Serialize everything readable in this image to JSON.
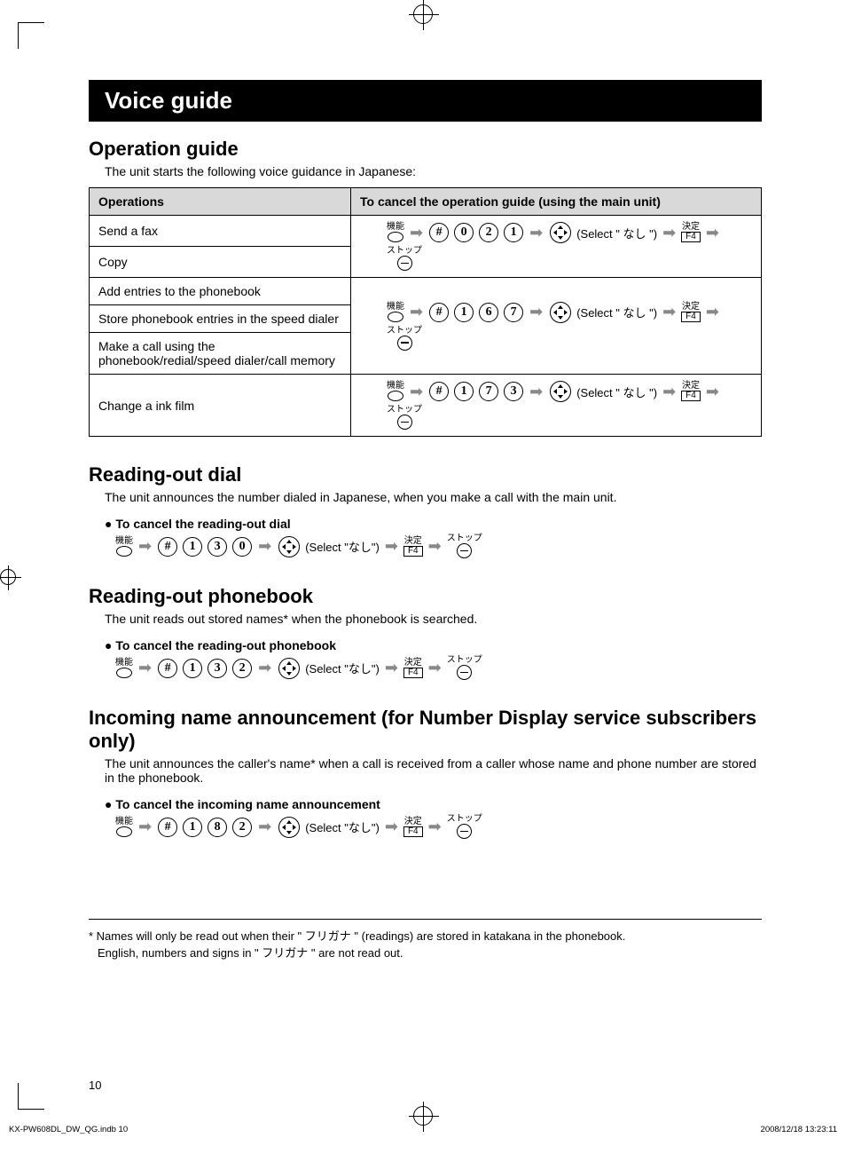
{
  "title_bar": "Voice guide",
  "op_guide": {
    "heading": "Operation guide",
    "intro": "The unit starts the following voice guidance in Japanese:",
    "th_ops": "Operations",
    "th_cancel": "To cancel the operation guide (using the main unit)",
    "rows": {
      "r1": "Send a fax",
      "r2": "Copy",
      "r3": "Add entries to the phonebook",
      "r4": "Store phonebook entries in the speed dialer",
      "r5": "Make a call using the phonebook/redial/speed dialer/call memory",
      "r6": "Change a ink film"
    },
    "codes": {
      "c1": [
        "0",
        "2",
        "1"
      ],
      "c2": [
        "1",
        "6",
        "7"
      ],
      "c3": [
        "1",
        "7",
        "3"
      ]
    }
  },
  "labels": {
    "kinou": "機能",
    "select_prefix": "(Select \"",
    "select_value": "なし",
    "select_suffix": "\")",
    "select_sp_prefix": "(Select \" ",
    "select_sp_suffix": " \")",
    "kettei": "決定",
    "f4": "F4",
    "stop": "ストップ",
    "hash": "#"
  },
  "dial": {
    "heading": "Reading-out dial",
    "intro": "The unit announces the number dialed in Japanese, when you make a call with the main unit.",
    "bullet": "To cancel the reading-out dial",
    "code": [
      "1",
      "3",
      "0"
    ]
  },
  "pb": {
    "heading": "Reading-out phonebook",
    "intro": "The unit reads out stored names* when the phonebook is searched.",
    "bullet": "To cancel the reading-out phonebook",
    "code": [
      "1",
      "3",
      "2"
    ]
  },
  "inc": {
    "heading": "Incoming name announcement (for Number Display service subscribers only)",
    "intro": "The unit announces the caller's name* when a call is received from a caller whose name and phone number are stored in the phonebook.",
    "bullet": "To cancel the incoming name announcement",
    "code": [
      "1",
      "8",
      "2"
    ]
  },
  "footnote_line1": "* Names will only be read out when their \" フリガナ \" (readings) are stored in katakana in the phonebook.",
  "footnote_line2": "English, numbers and signs in \" フリガナ \" are not read out.",
  "page_number": "10",
  "footer_left": "KX-PW608DL_DW_QG.indb   10",
  "footer_right": "2008/12/18   13:23:11"
}
